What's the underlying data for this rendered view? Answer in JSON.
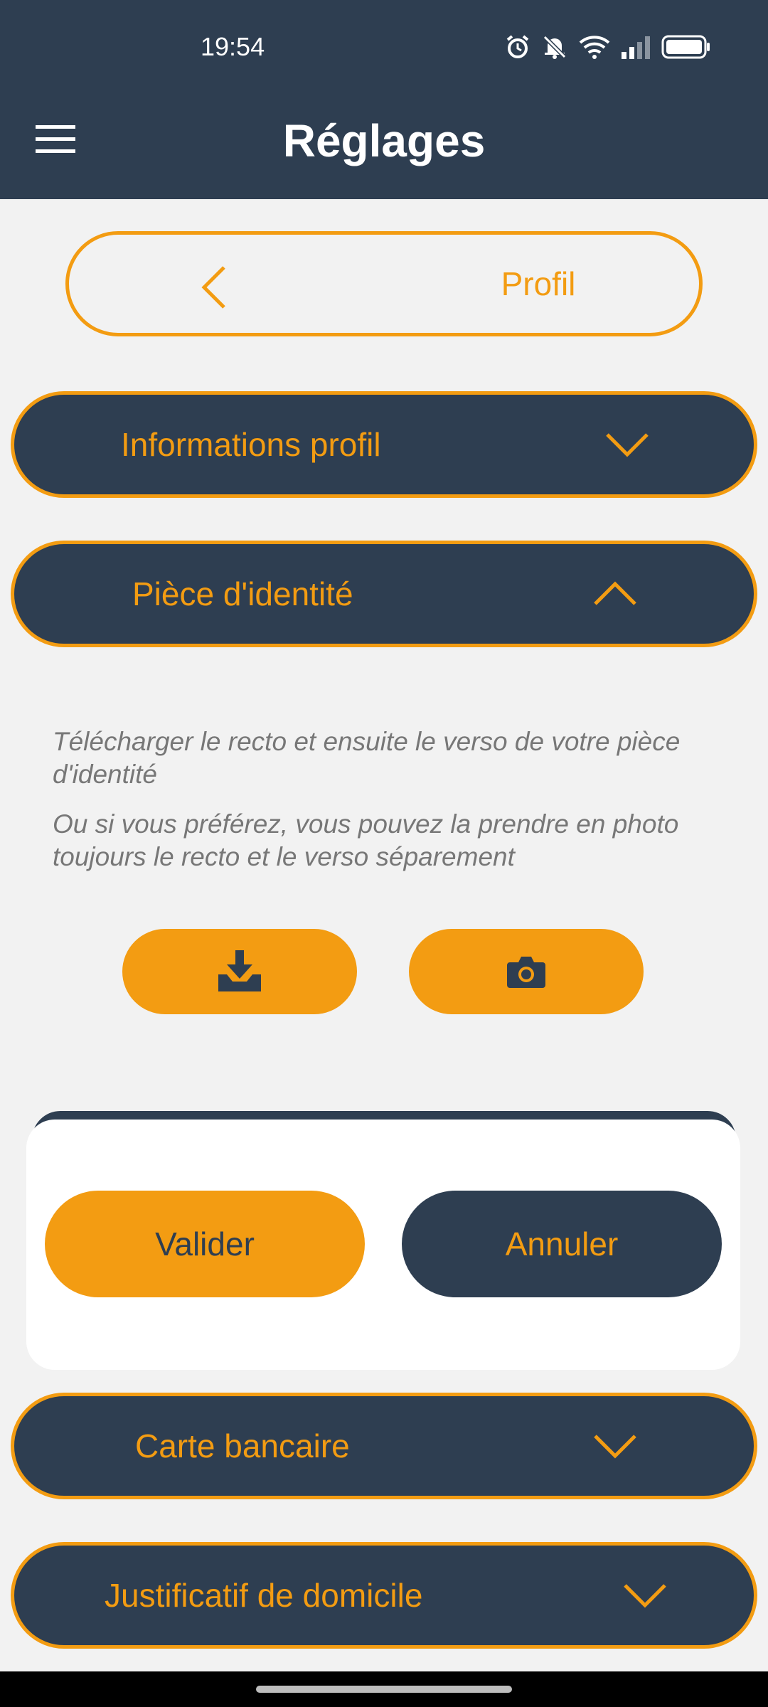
{
  "status_bar": {
    "time": "19:54",
    "icons": [
      "alarm-icon",
      "mute-icon",
      "wifi-icon",
      "signal-icon",
      "battery-icon"
    ]
  },
  "header": {
    "title": "Réglages",
    "menu_icon": "hamburger-menu-icon"
  },
  "profil_button": {
    "label": "Profil",
    "icon": "chevron-left-icon"
  },
  "sections": {
    "informations": {
      "label": "Informations profil",
      "state": "collapsed"
    },
    "piece_identite": {
      "label": "Pièce d'identité",
      "state": "expanded",
      "hint_1": "Télécharger le recto et ensuite le verso de votre pièce d'identité",
      "hint_2": "Ou si vous préférez, vous pouvez la prendre en photo toujours le recto et le verso séparement",
      "upload_icon": "download-tray-icon",
      "camera_icon": "camera-icon"
    },
    "carte_bancaire": {
      "label": "Carte bancaire",
      "state": "collapsed"
    },
    "justificatif": {
      "label": "Justificatif de domicile",
      "state": "collapsed"
    }
  },
  "dialog": {
    "validate_label": "Valider",
    "cancel_label": "Annuler"
  },
  "colors": {
    "primary_dark": "#2e3e51",
    "accent_orange": "#f39c12",
    "background": "#f2f2f2",
    "hint_text": "#777777"
  }
}
